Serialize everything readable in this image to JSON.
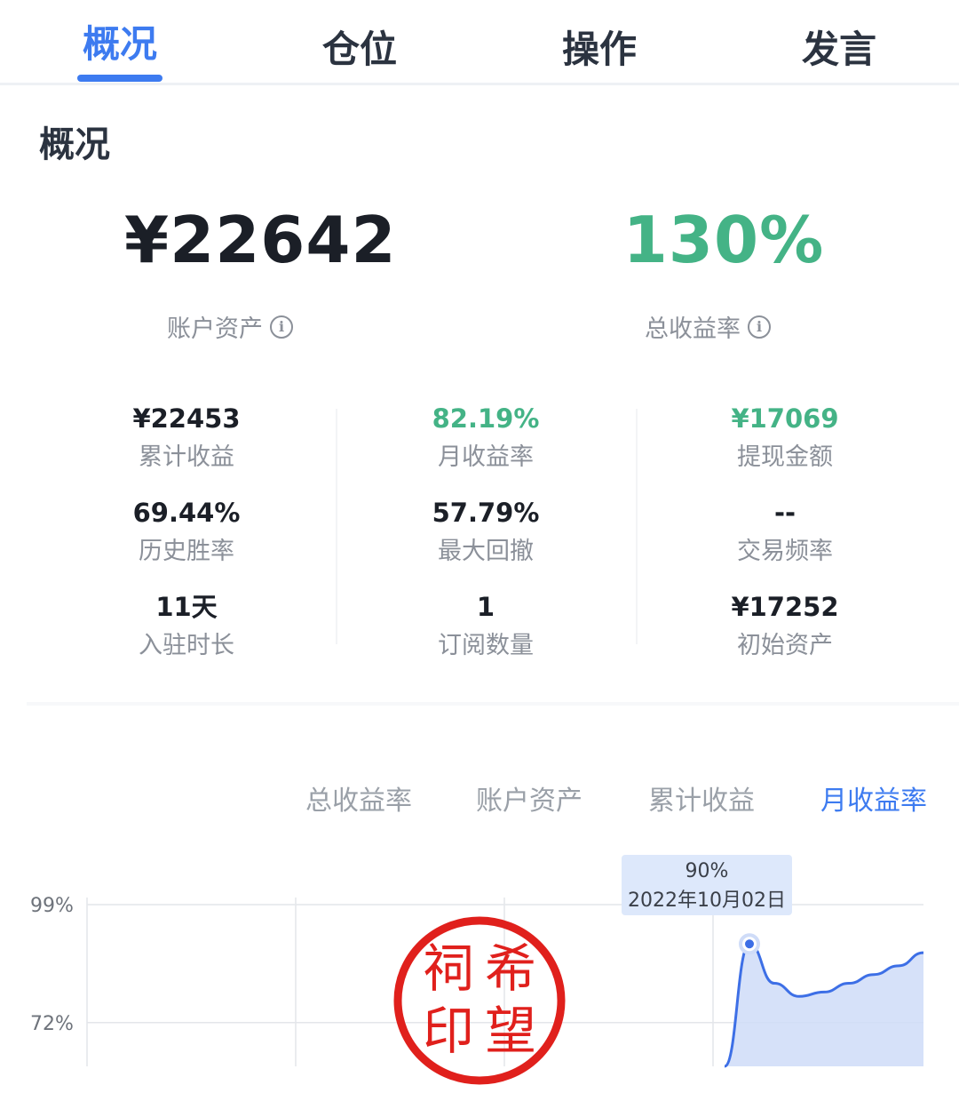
{
  "tabs": [
    {
      "label": "概况",
      "active": true
    },
    {
      "label": "仓位",
      "active": false
    },
    {
      "label": "操作",
      "active": false
    },
    {
      "label": "发言",
      "active": false
    }
  ],
  "section_title": "概况",
  "summary": {
    "asset_value": "¥22642",
    "asset_label": "账户资产",
    "return_value": "130%",
    "return_label": "总收益率"
  },
  "stats": [
    {
      "value": "¥22453",
      "label": "累计收益",
      "color": "#1b1f27"
    },
    {
      "value": "82.19%",
      "label": "月收益率",
      "color": "#44b386"
    },
    {
      "value": "¥17069",
      "label": "提现金额",
      "color": "#44b386"
    },
    {
      "value": "69.44%",
      "label": "历史胜率",
      "color": "#1b1f27"
    },
    {
      "value": "57.79%",
      "label": "最大回撤",
      "color": "#1b1f27"
    },
    {
      "value": "--",
      "label": "交易频率",
      "color": "#1b1f27"
    },
    {
      "value": "11天",
      "label": "入驻时长",
      "color": "#1b1f27"
    },
    {
      "value": "1",
      "label": "订阅数量",
      "color": "#1b1f27"
    },
    {
      "value": "¥17252",
      "label": "初始资产",
      "color": "#1b1f27"
    }
  ],
  "chart_tabs": [
    {
      "label": "总收益率",
      "active": false
    },
    {
      "label": "账户资产",
      "active": false
    },
    {
      "label": "累计收益",
      "active": false
    },
    {
      "label": "月收益率",
      "active": true
    }
  ],
  "tooltip": {
    "value": "90%",
    "date": "2022年10月02日"
  },
  "seal": {
    "chars": [
      "祠",
      "希",
      "印",
      "望"
    ],
    "color": "#e0201c"
  },
  "colors": {
    "accent": "#3d7bf0",
    "positive": "#44b386",
    "line": "#3d6fe6",
    "area": "#cfdcf8"
  },
  "chart_data": {
    "type": "area",
    "ytick_labels": [
      "99%",
      "72%"
    ],
    "yticks": [
      99,
      72
    ],
    "ylim": [
      62,
      99
    ],
    "highlight_point": {
      "value": 90,
      "label": "2022年10月02日"
    },
    "series": [
      {
        "x": [
          0,
          1,
          2,
          3,
          4,
          5,
          6,
          7,
          8
        ],
        "y": [
          32,
          90,
          81,
          78,
          79,
          81,
          83,
          85,
          88
        ]
      }
    ],
    "grid": true
  }
}
